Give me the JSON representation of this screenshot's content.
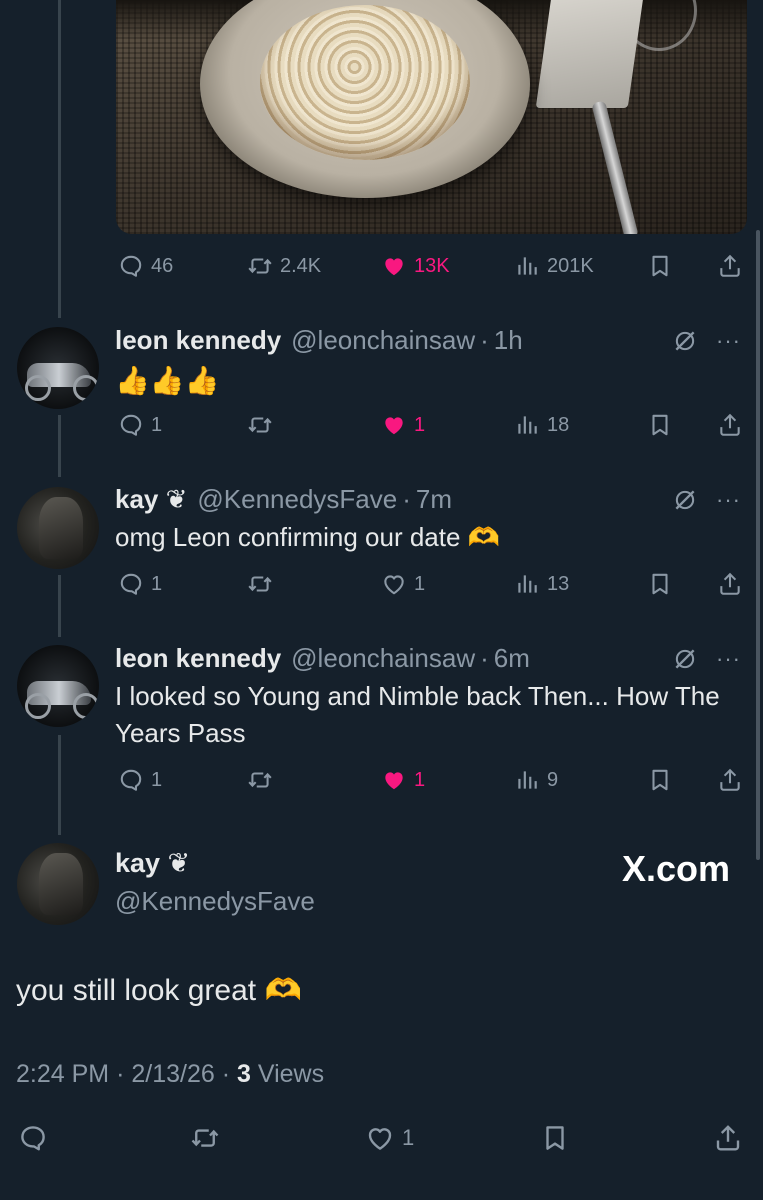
{
  "colors": {
    "background": "#15202b",
    "text": "#e7e9ea",
    "muted": "#8b98a5",
    "like": "#f91880",
    "thread_line": "#38444d"
  },
  "parent_post": {
    "image_description_icon": "pasta-photo",
    "metrics": {
      "replies": "46",
      "reposts": "2.4K",
      "likes": "13K",
      "views": "201K"
    },
    "liked": true
  },
  "replies": [
    {
      "name": "leon kennedy",
      "handle": "@leonchainsaw",
      "separator": "·",
      "time": "1h",
      "text": "👍👍👍",
      "metrics": {
        "replies": "1",
        "reposts": "",
        "likes": "1",
        "views": "18"
      },
      "liked": true
    },
    {
      "name": "kay ❦",
      "handle": "@KennedysFave",
      "separator": "·",
      "time": "7m",
      "text": "omg Leon confirming our date 🫶",
      "metrics": {
        "replies": "1",
        "reposts": "",
        "likes": "1",
        "views": "13"
      },
      "liked": false
    },
    {
      "name": "leon kennedy",
      "handle": "@leonchainsaw",
      "separator": "·",
      "time": "6m",
      "text": "I looked so Young and Nimble back Then... How The Years Pass",
      "metrics": {
        "replies": "1",
        "reposts": "",
        "likes": "1",
        "views": "9"
      },
      "liked": true
    }
  ],
  "main_post": {
    "name": "kay ❦",
    "handle": "@KennedysFave",
    "watermark": "X.com",
    "text": "you still look great 🫶",
    "time": "2:24 PM",
    "sep1": "·",
    "date": "2/13/26",
    "sep2": "·",
    "views_count": "3",
    "views_label": "Views",
    "metrics": {
      "replies": "",
      "reposts": "",
      "likes": "1"
    }
  },
  "more_glyph": "···"
}
